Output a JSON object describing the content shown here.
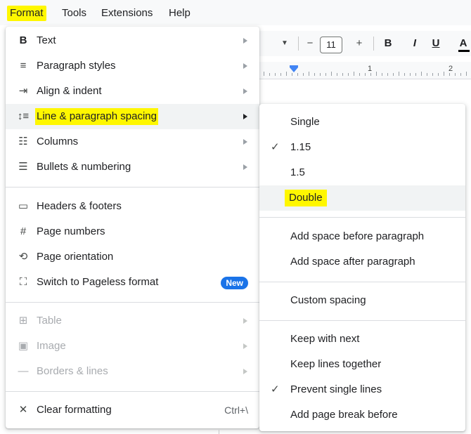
{
  "menubar": {
    "items": [
      {
        "label": "Format",
        "highlighted": true
      },
      {
        "label": "Tools"
      },
      {
        "label": "Extensions"
      },
      {
        "label": "Help"
      }
    ]
  },
  "toolbar": {
    "font_size": "11",
    "minus": "−",
    "plus": "+",
    "bold": "B",
    "italic": "I",
    "underline": "U",
    "text_color": "A"
  },
  "ruler": {
    "labels": [
      "1",
      "2"
    ]
  },
  "format_menu": {
    "items": [
      {
        "label": "Text",
        "icon": "bold-icon",
        "submenu": true
      },
      {
        "label": "Paragraph styles",
        "icon": "paragraph-styles-icon",
        "submenu": true
      },
      {
        "label": "Align & indent",
        "icon": "align-indent-icon",
        "submenu": true
      },
      {
        "label": "Line & paragraph spacing",
        "icon": "line-spacing-icon",
        "submenu": true,
        "highlighted": true
      },
      {
        "label": "Columns",
        "icon": "columns-icon",
        "submenu": true
      },
      {
        "label": "Bullets & numbering",
        "icon": "bulleted-list-icon",
        "submenu": true
      },
      {
        "label": "Headers & footers",
        "icon": "headers-footers-icon"
      },
      {
        "label": "Page numbers",
        "icon": "hash-icon"
      },
      {
        "label": "Page orientation",
        "icon": "page-orientation-icon"
      },
      {
        "label": "Switch to Pageless format",
        "icon": "pageless-icon",
        "badge": "New"
      },
      {
        "label": "Table",
        "icon": "table-icon",
        "submenu": true,
        "disabled": true
      },
      {
        "label": "Image",
        "icon": "image-icon",
        "submenu": true,
        "disabled": true
      },
      {
        "label": "Borders & lines",
        "icon": "borders-lines-icon",
        "submenu": true,
        "disabled": true
      },
      {
        "label": "Clear formatting",
        "icon": "clear-formatting-icon",
        "shortcut": "Ctrl+\\"
      }
    ]
  },
  "spacing_submenu": {
    "items": [
      {
        "label": "Single",
        "checked": false
      },
      {
        "label": "1.15",
        "checked": true
      },
      {
        "label": "1.5",
        "checked": false
      },
      {
        "label": "Double",
        "checked": false,
        "highlighted": true
      },
      {
        "label": "Add space before paragraph"
      },
      {
        "label": "Add space after paragraph"
      },
      {
        "label": "Custom spacing"
      },
      {
        "label": "Keep with next"
      },
      {
        "label": "Keep lines together"
      },
      {
        "label": "Prevent single lines",
        "checked": true
      },
      {
        "label": "Add page break before"
      }
    ]
  },
  "colors": {
    "highlight": "#fff700",
    "badge": "#1a73e8",
    "hover_bg": "#f1f3f4"
  }
}
